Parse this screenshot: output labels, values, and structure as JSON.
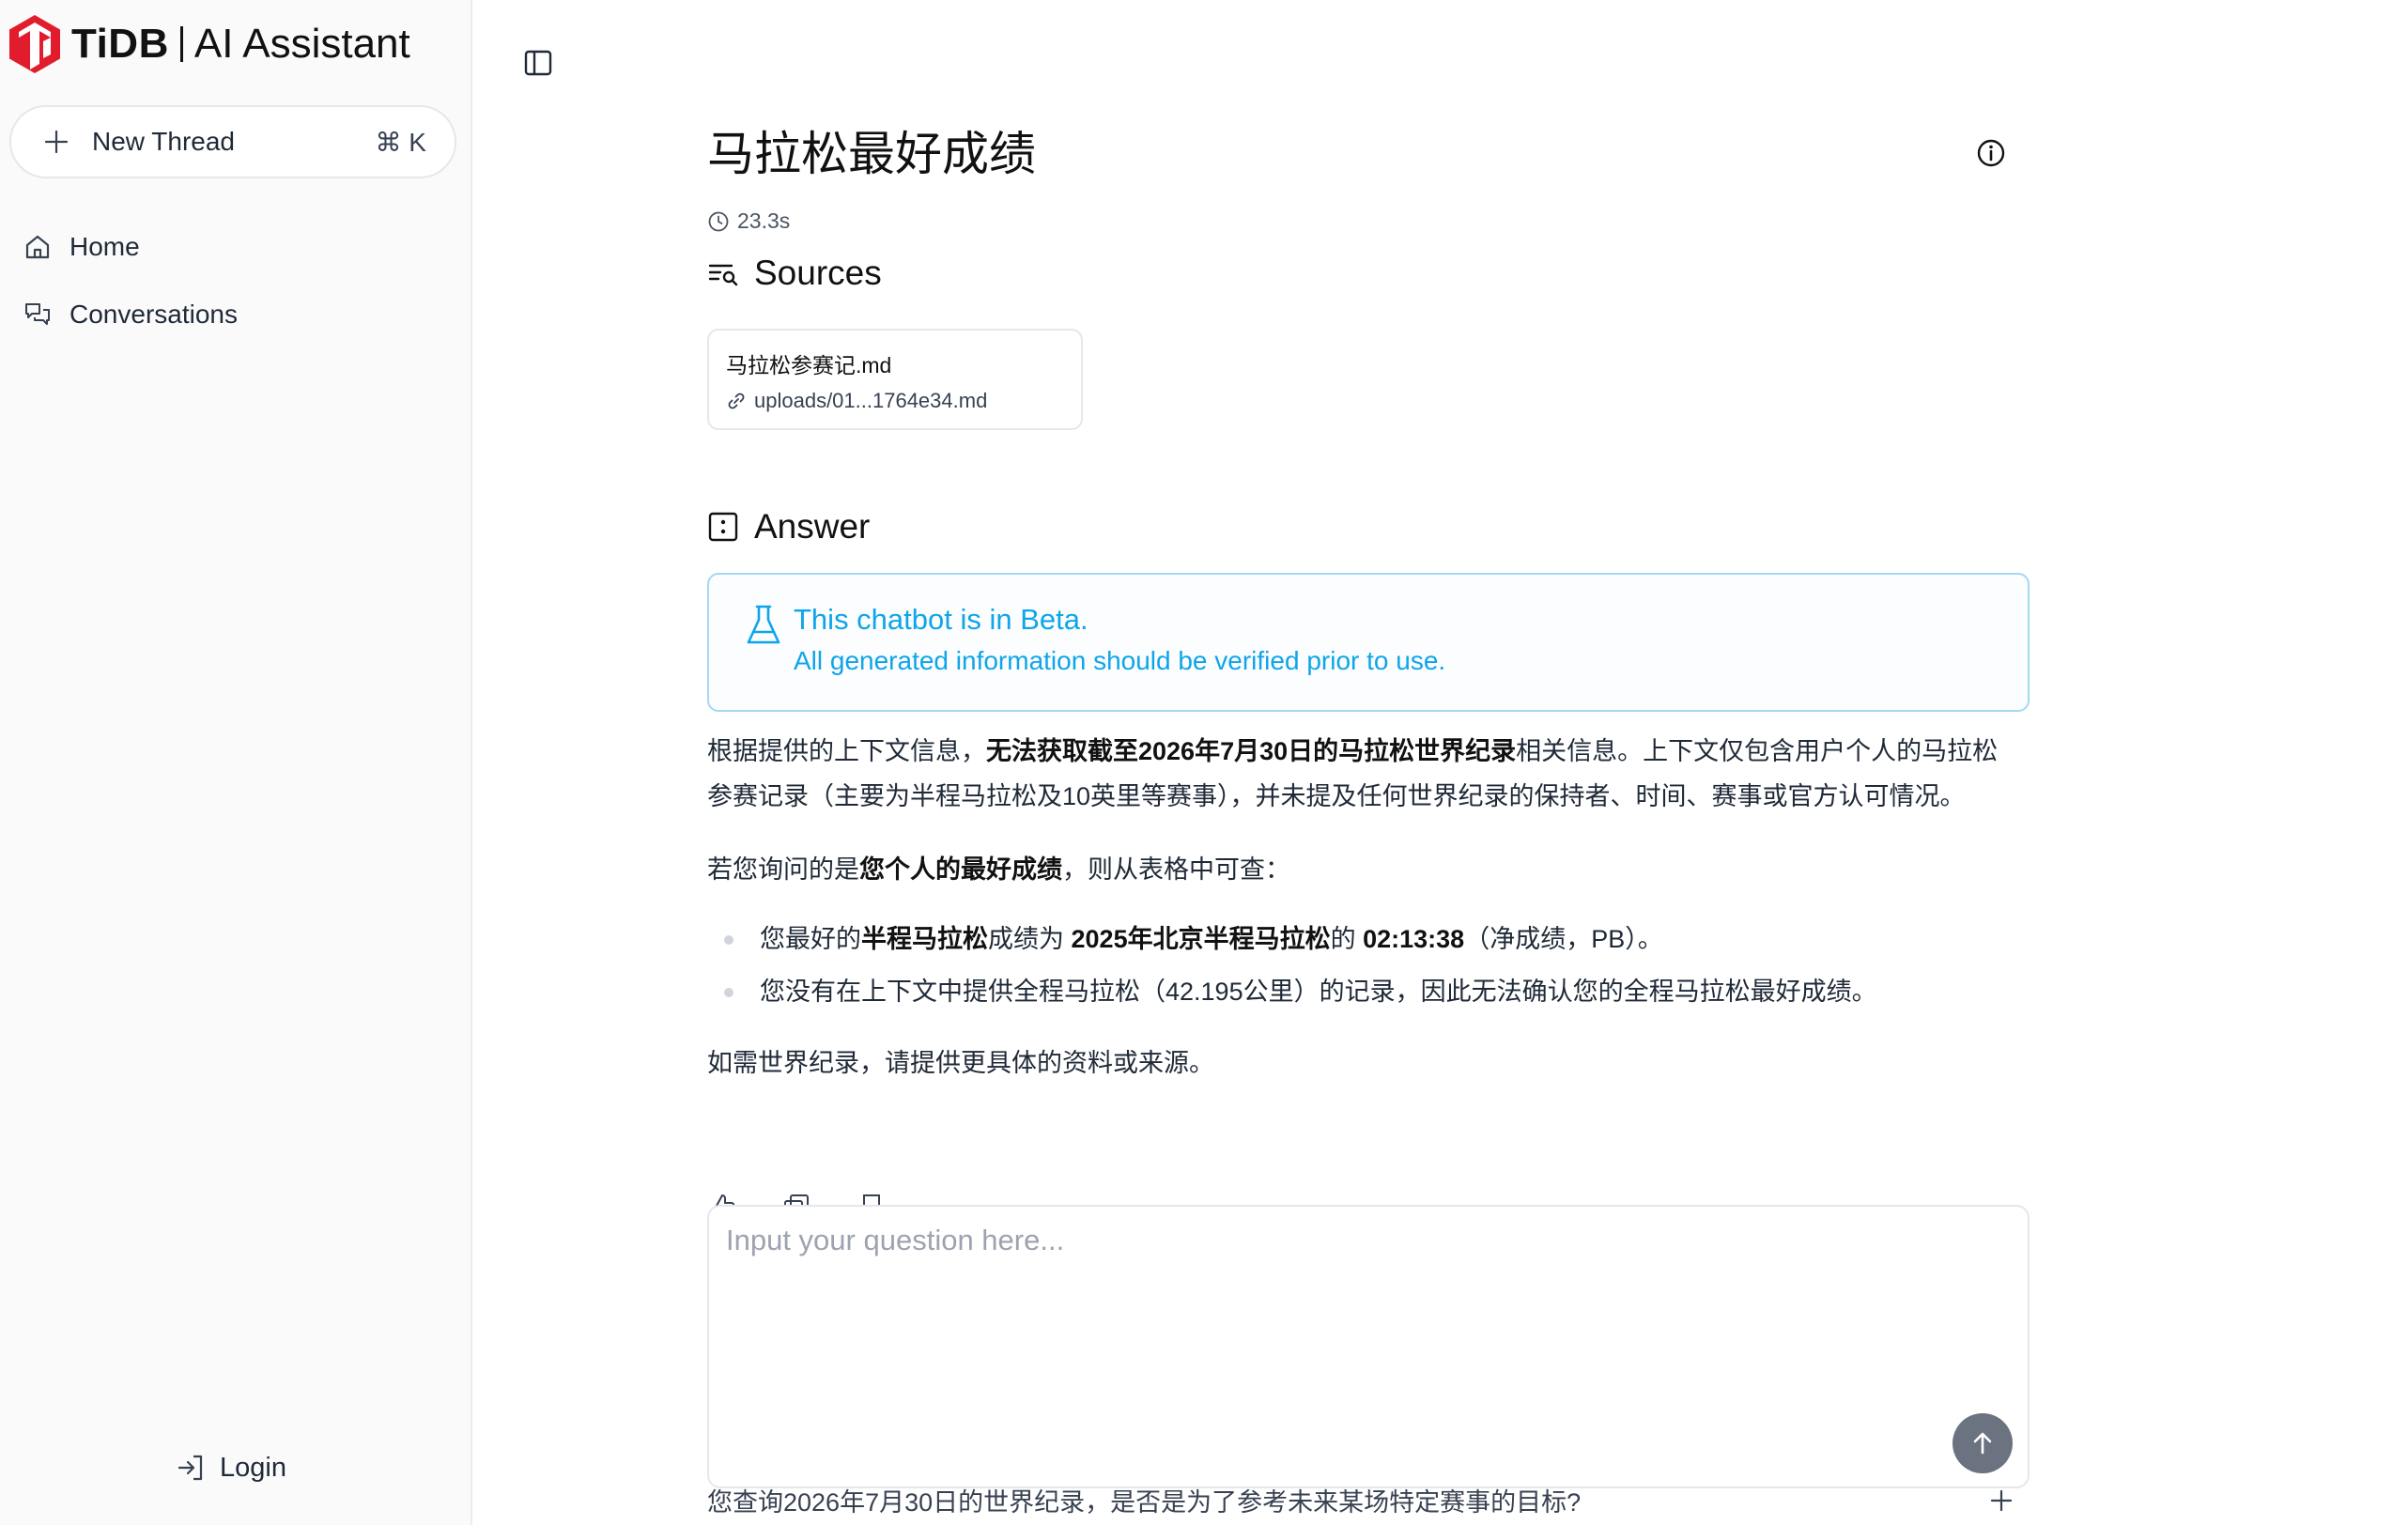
{
  "brand": {
    "name": "TiDB",
    "product": "AI Assistant",
    "color": "#e11d2d"
  },
  "sidebar": {
    "new_thread_label": "New Thread",
    "new_thread_shortcut": "⌘ K",
    "nav": [
      {
        "label": "Home",
        "icon": "home-icon"
      },
      {
        "label": "Conversations",
        "icon": "conversations-icon"
      }
    ],
    "login_label": "Login"
  },
  "main": {
    "title": "马拉松最好成绩",
    "elapsed": "23.3s",
    "sources_heading": "Sources",
    "sources": [
      {
        "name": "马拉松参赛记.md",
        "path": "uploads/01...1764e34.md"
      }
    ],
    "answer_heading": "Answer",
    "beta": {
      "title": "This chatbot is in Beta.",
      "description": "All generated information should be verified prior to use.",
      "color": "#0ea5e9"
    },
    "answer": {
      "p1_a": "根据提供的上下文信息，",
      "p1_b": "无法获取截至2026年7月30日的马拉松世界纪录",
      "p1_c": "相关信息。上下文仅包含用户个人的马拉松参赛记录（主要为半程马拉松及10英里等赛事），并未提及任何世界纪录的保持者、时间、赛事或官方认可情况。",
      "p2_a": "若您询问的是",
      "p2_b": "您个人的最好成绩",
      "p2_c": "，则从表格中可查：",
      "b1_a": "您最好的",
      "b1_b": "半程马拉松",
      "b1_c": "成绩为 ",
      "b1_d": "2025年北京半程马拉松",
      "b1_e": "的 ",
      "b1_f": "02:13:38",
      "b1_g": "（净成绩，PB）。",
      "b2": "您没有在上下文中提供全程马拉松（42.195公里）的记录，因此无法确认您的全程马拉松最好成绩。",
      "p4": "如需世界纪录，请提供更具体的资料或来源。"
    },
    "input_placeholder": "Input your question here...",
    "suggestion": "您查询2026年7月30日的世界纪录，是否是为了参考未来某场特定赛事的目标?"
  }
}
